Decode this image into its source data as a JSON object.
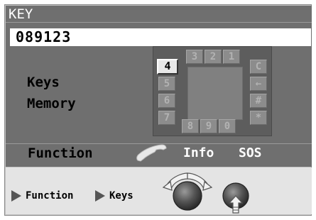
{
  "title": "KEY",
  "entry_value": "089123",
  "menu": {
    "items": [
      "Keys",
      "Memory"
    ]
  },
  "keypad": {
    "top_row": [
      "3",
      "2",
      "1"
    ],
    "left_col": [
      "4",
      "5",
      "6",
      "7"
    ],
    "bottom_row": [
      "8",
      "9",
      "0"
    ],
    "right_col": [
      "C",
      "←",
      "#",
      "*"
    ],
    "selected_key": "4"
  },
  "function_bar": {
    "label": "Function",
    "phone_icon": "phone-icon",
    "info": "Info",
    "sos": "SOS"
  },
  "hints": {
    "function": "Function",
    "keys": "Keys"
  },
  "colors": {
    "screen": "#6f6f6f",
    "hint_bg": "#e4e4e4",
    "key_active": "#e8e8e8"
  }
}
